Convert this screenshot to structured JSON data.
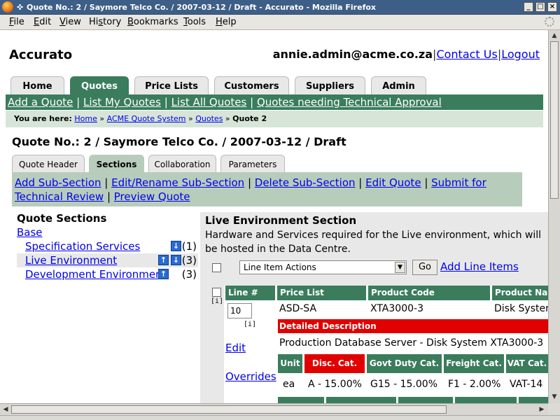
{
  "window": {
    "title": "Quote No.: 2 / Saymore Telco Co. / 2007-03-12 / Draft - Accurato - Mozilla Firefox",
    "controls": [
      "_",
      "□",
      "×"
    ]
  },
  "menubar": [
    {
      "u": "F",
      "rest": "ile"
    },
    {
      "u": "E",
      "rest": "dit"
    },
    {
      "u": "V",
      "rest": "iew"
    },
    {
      "pre": "Hi",
      "u": "s",
      "rest": "tory"
    },
    {
      "u": "B",
      "rest": "ookmarks"
    },
    {
      "u": "T",
      "rest": "ools"
    },
    {
      "u": "H",
      "rest": "elp"
    }
  ],
  "header": {
    "app_name": "Accurato",
    "user_email": "annie.admin@acme.co.za",
    "contact_us": "Contact Us",
    "logout": "Logout"
  },
  "main_tabs": [
    "Home",
    "Quotes",
    "Price Lists",
    "Customers",
    "Suppliers",
    "Admin"
  ],
  "subnav": [
    "Add a Quote",
    "List My Quotes",
    "List All Quotes",
    "Quotes needing Technical Approval"
  ],
  "breadcrumb": {
    "label": "You are here:",
    "items": [
      "Home",
      "ACME Quote System",
      "Quotes"
    ],
    "current": "Quote 2",
    "separator": "»"
  },
  "quote_title": "Quote No.: 2 / Saymore Telco Co. / 2007-03-12 / Draft",
  "sub_tabs": [
    "Quote Header",
    "Sections",
    "Collaboration",
    "Parameters"
  ],
  "actions": [
    "Add Sub-Section",
    "Edit/Rename Sub-Section",
    "Delete Sub-Section",
    "Edit Quote",
    "Submit for Technical Review",
    "Preview Quote"
  ],
  "sections": {
    "heading": "Quote Sections",
    "base": "Base",
    "items": [
      {
        "name": "Specification Services",
        "count": "(1)"
      },
      {
        "name": "Live Environment",
        "count": "(3)"
      },
      {
        "name": "Development Environment",
        "count": "(3)"
      }
    ]
  },
  "live_section": {
    "heading": "Live Environment Section",
    "description": "Hardware and Services required for the Live environment, which will be hosted in the Data Centre.",
    "line_actions": "Line Item Actions",
    "go": "Go",
    "add_line_items": "Add Line Items",
    "info_icon": "[i]",
    "columns": [
      "Line #",
      "Price List",
      "Product Code",
      "Product Name"
    ],
    "row": {
      "line_no": "10",
      "price_list": "ASD-SA",
      "product_code": "XTA3000-3",
      "product_name": "Disk System"
    },
    "detailed_description_label": "Detailed Description",
    "detailed_description": "Production Database Server - Disk System XTA3000-3",
    "edit": "Edit",
    "overrides": "Overrides",
    "cost_columns": [
      "Unit",
      "Disc. Cat.",
      "Govt Duty Cat.",
      "Freight Cat.",
      "VAT Cat."
    ],
    "cost_row": [
      "ea",
      "A - 15.00%",
      "G15 - 15.00%",
      "F1 - 2.00%",
      "VAT-14"
    ]
  }
}
